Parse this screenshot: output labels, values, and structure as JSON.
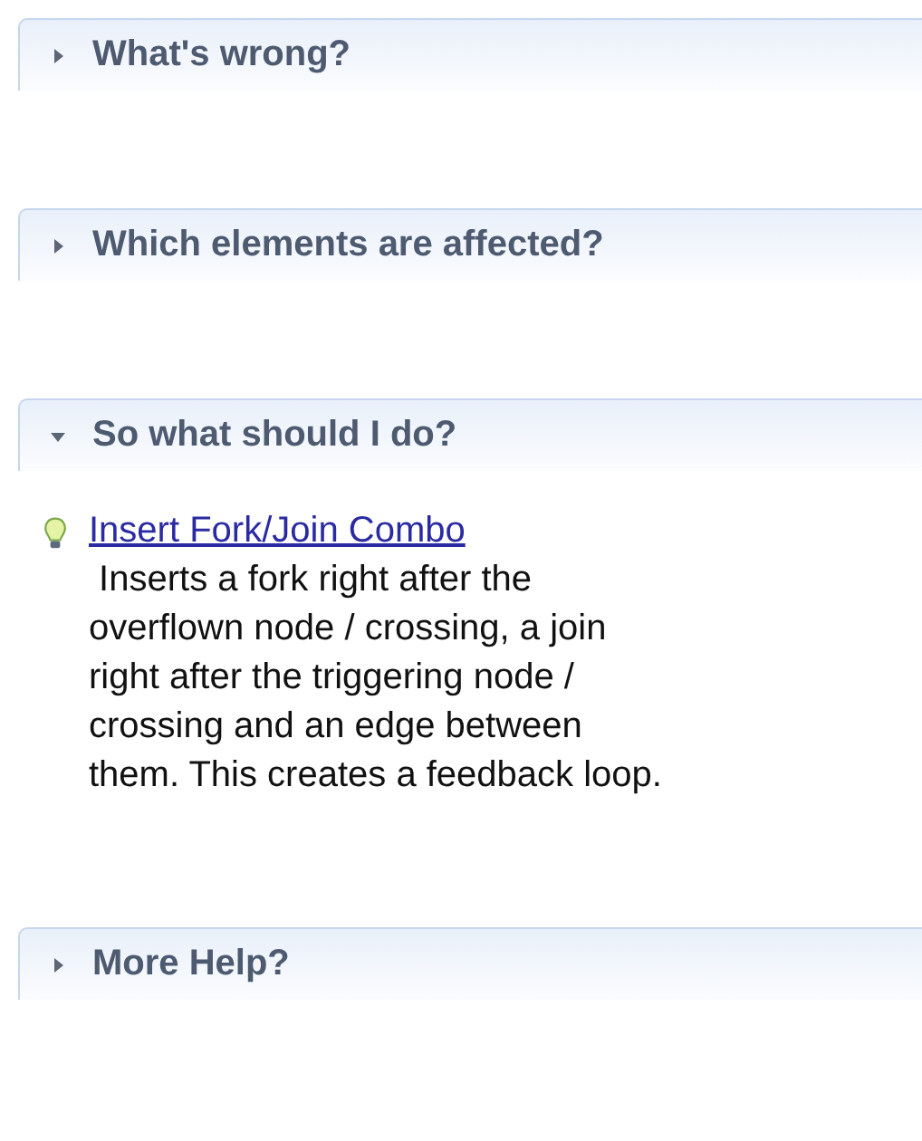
{
  "sections": [
    {
      "title": "What's wrong?",
      "expanded": false
    },
    {
      "title": "Which elements are affected?",
      "expanded": false
    },
    {
      "title": "So what should I do?",
      "expanded": true,
      "fixes": [
        {
          "link": "Insert Fork/Join Combo",
          "description": "Inserts a fork right after the overflown node / crossing, a join right after the triggering node / crossing and an edge between them. This creates a feedback loop."
        }
      ]
    },
    {
      "title": "More Help?",
      "expanded": false
    }
  ]
}
